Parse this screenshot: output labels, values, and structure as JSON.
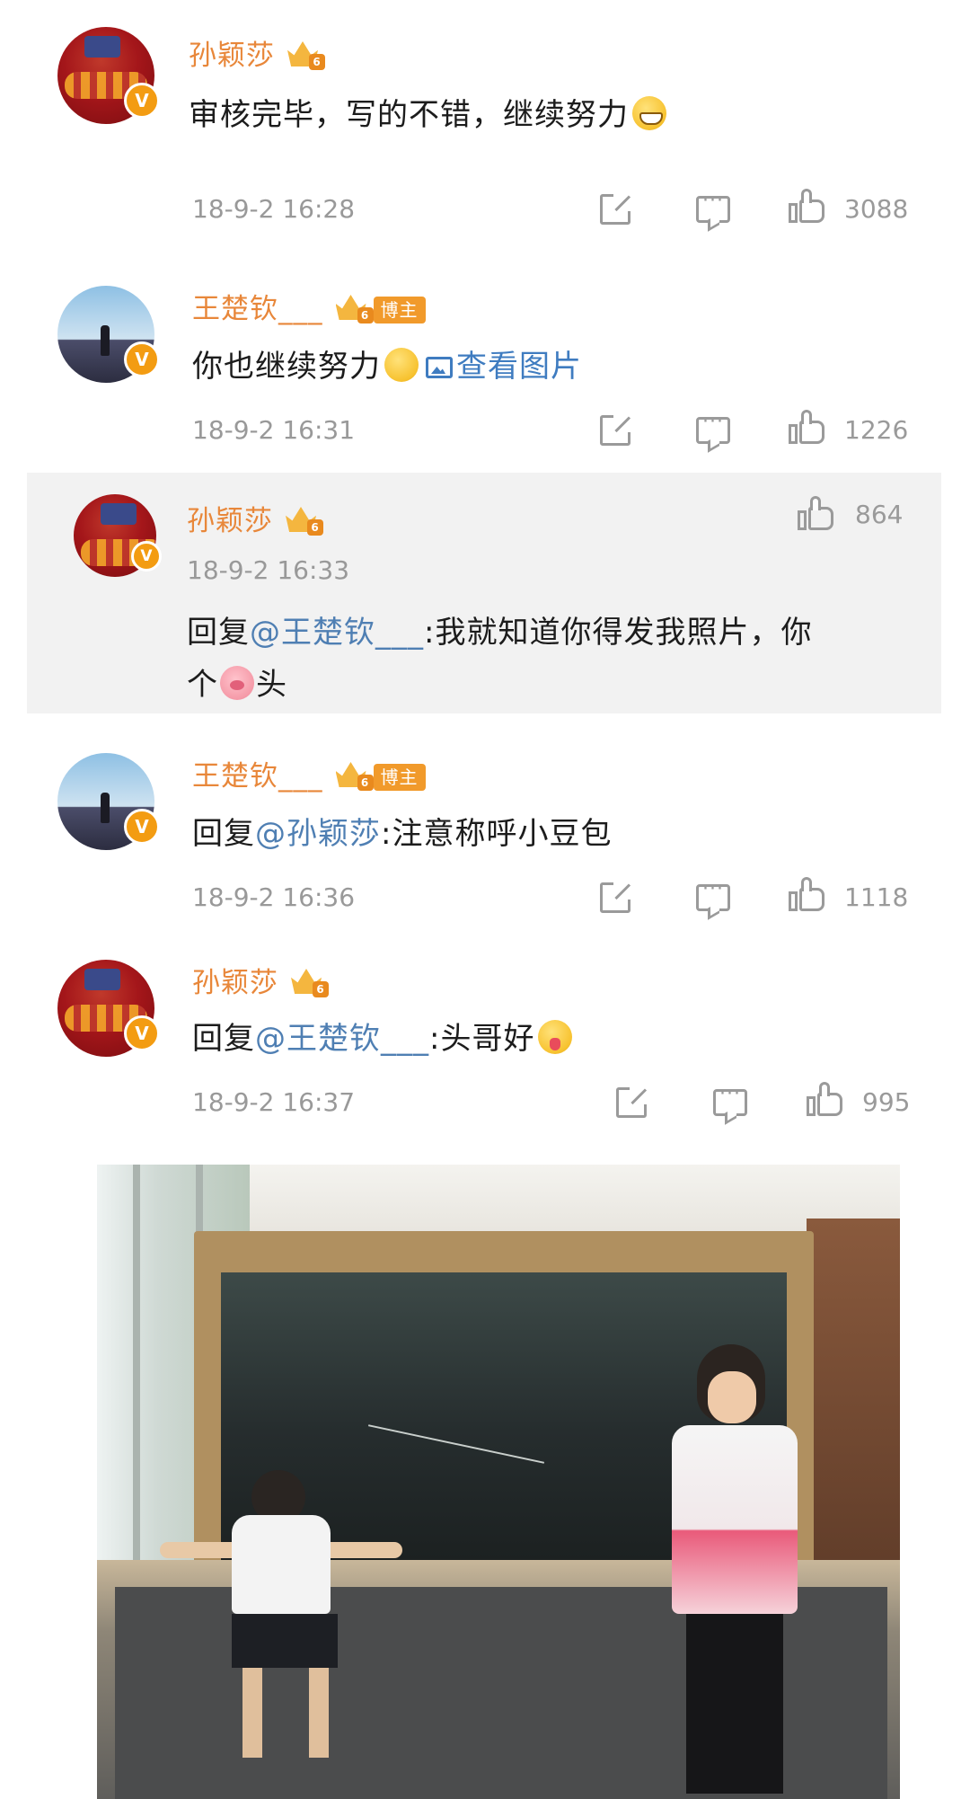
{
  "comments": [
    {
      "username": "孙颖莎",
      "level": "6",
      "text": "审核完毕，写的不错，继续努力",
      "time": "18-9-2 16:28",
      "likes": "3088"
    },
    {
      "username": "王楚钦___",
      "level": "6",
      "tag": "博主",
      "text": "你也继续努力",
      "view_image": "查看图片",
      "time": "18-9-2 16:31",
      "likes": "1226"
    },
    {
      "username": "孙颖莎",
      "level": "6",
      "time": "18-9-2 16:33",
      "likes": "864",
      "reply_prefix": "回复",
      "mention": "@王楚钦___",
      "text_line1": ":我就知道你得发我照片，你",
      "text_line2_a": "个",
      "text_line2_b": "头"
    },
    {
      "username": "王楚钦___",
      "level": "6",
      "tag": "博主",
      "reply_prefix": "回复",
      "mention": "@孙颖莎",
      "text": ":注意称呼小豆包",
      "time": "18-9-2 16:36",
      "likes": "1118"
    },
    {
      "username": "孙颖莎",
      "level": "6",
      "reply_prefix": "回复",
      "mention": "@王楚钦___",
      "text": ":头哥好",
      "time": "18-9-2 16:37",
      "likes": "995"
    }
  ],
  "icons": {
    "verified": "V",
    "share": "share-icon",
    "comment": "comment-icon",
    "like": "like-icon"
  },
  "colors": {
    "username": "#e8873a",
    "mention": "#4f7fb3",
    "meta": "#999999",
    "reply_bg": "#f2f2f2"
  }
}
